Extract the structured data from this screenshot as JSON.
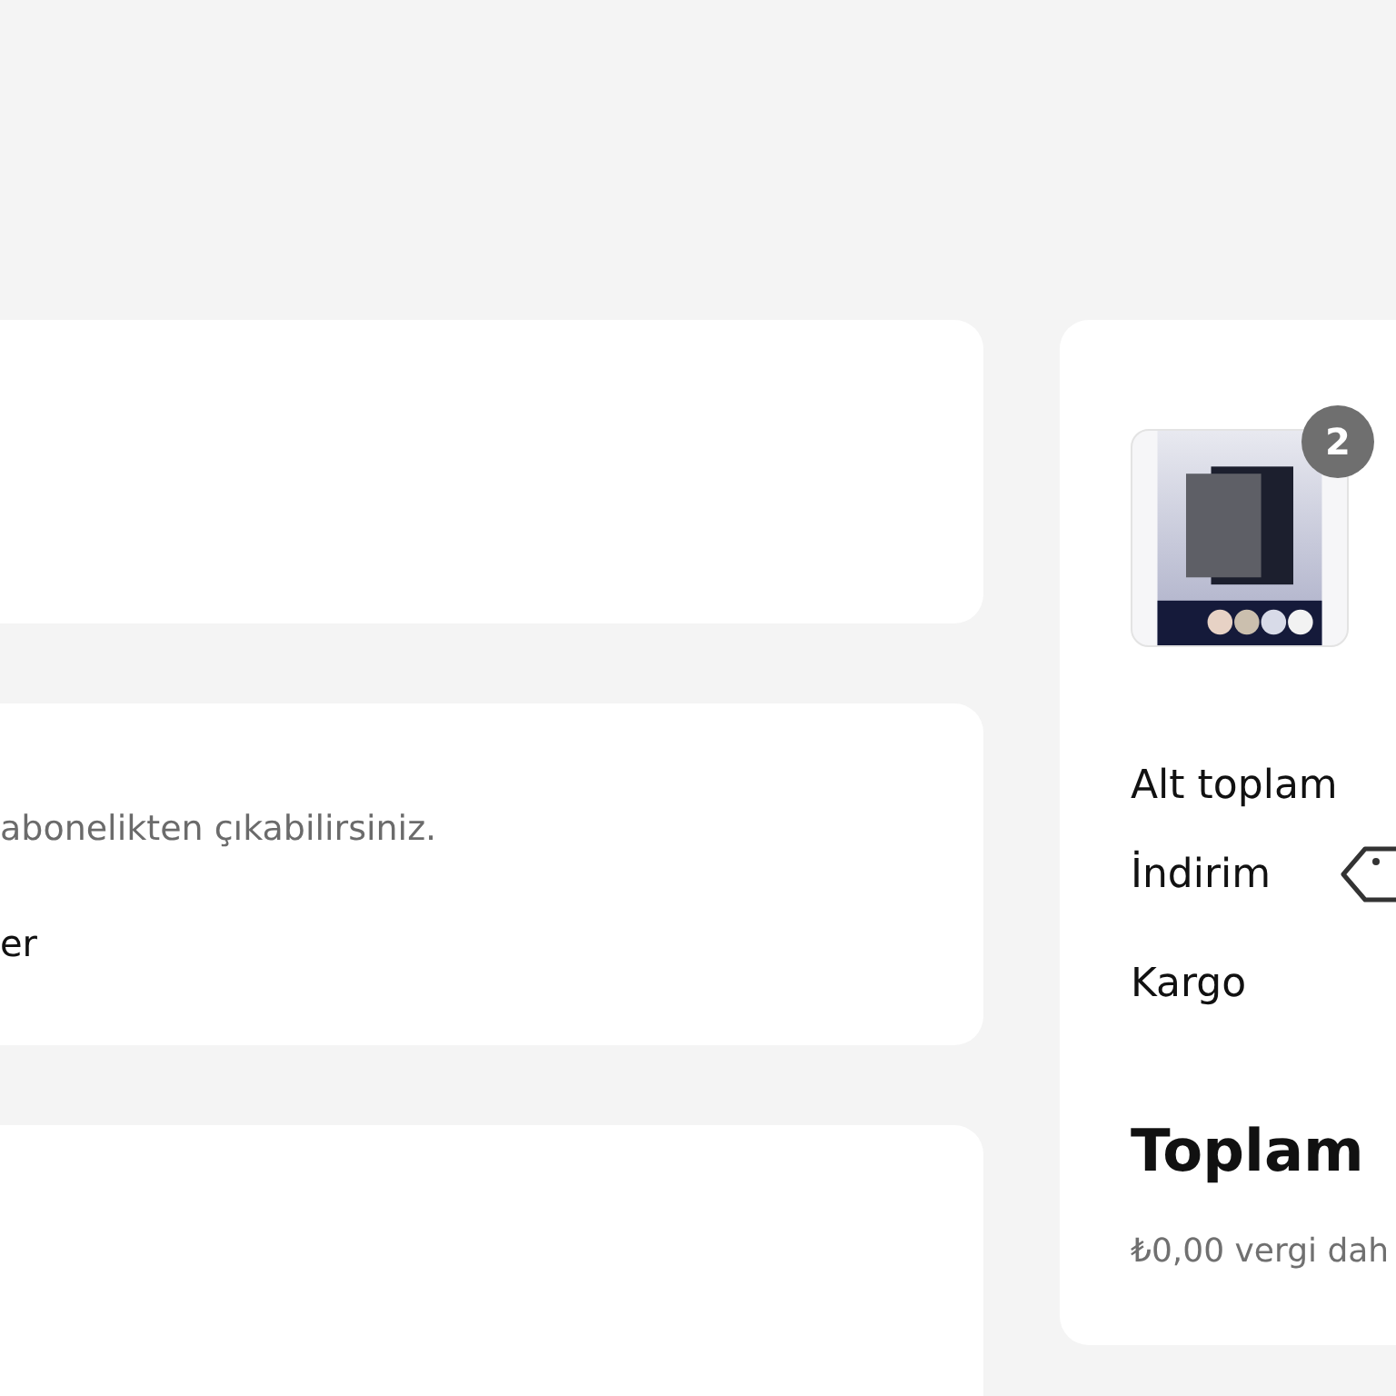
{
  "left_cards": [
    {
      "kind": "empty"
    },
    {
      "kind": "text",
      "lines": [
        {
          "kind": "note",
          "text": "abonelikten çıkabilirsiniz."
        },
        {
          "kind": "label",
          "text": "er"
        }
      ]
    },
    {
      "kind": "empty"
    }
  ],
  "summary": {
    "product": {
      "kind": "picture",
      "quantity": "2"
    },
    "rows": [
      {
        "label": "Alt toplam",
        "kind": "plain"
      },
      {
        "label": "İndirim",
        "kind": "discount"
      },
      {
        "label": "Kargo",
        "kind": "plain"
      }
    ],
    "total": {
      "label": "Toplam"
    },
    "tax_note": "₺0,00 vergi dah"
  }
}
